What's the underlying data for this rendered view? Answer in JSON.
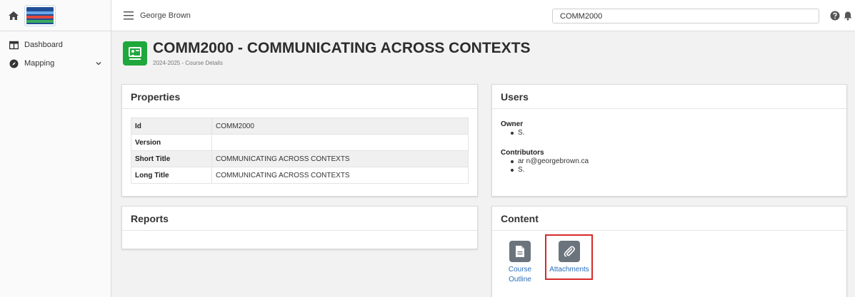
{
  "header": {
    "org_name": "George Brown",
    "search_value": "COMM2000"
  },
  "sidebar": {
    "items": [
      {
        "label": "Dashboard",
        "icon": "columns-icon"
      },
      {
        "label": "Mapping",
        "icon": "compass-icon"
      }
    ]
  },
  "page": {
    "title": "COMM2000 - COMMUNICATING ACROSS CONTEXTS",
    "subtitle": "2024-2025 - Course Details"
  },
  "properties": {
    "heading": "Properties",
    "rows": [
      {
        "key": "Id",
        "value": "COMM2000"
      },
      {
        "key": "Version",
        "value": ""
      },
      {
        "key": "Short Title",
        "value": "COMMUNICATING ACROSS CONTEXTS"
      },
      {
        "key": "Long Title",
        "value": "COMMUNICATING ACROSS CONTEXTS"
      }
    ]
  },
  "users": {
    "heading": "Users",
    "owner_label": "Owner",
    "owners": [
      "S."
    ],
    "contributors_label": "Contributors",
    "contributors": [
      "ar        n@georgebrown.ca",
      "S."
    ]
  },
  "reports": {
    "heading": "Reports"
  },
  "content": {
    "heading": "Content",
    "tiles": [
      {
        "label_line1": "Course",
        "label_line2": "Outline",
        "icon": "document-icon"
      },
      {
        "label_line1": "Attachments",
        "label_line2": "",
        "icon": "paperclip-icon"
      }
    ]
  },
  "colors": {
    "brand_green": "#1ea83c",
    "tile_gray": "#6b747c",
    "link_blue": "#2a6fba",
    "highlight_red": "#d62a2a"
  }
}
